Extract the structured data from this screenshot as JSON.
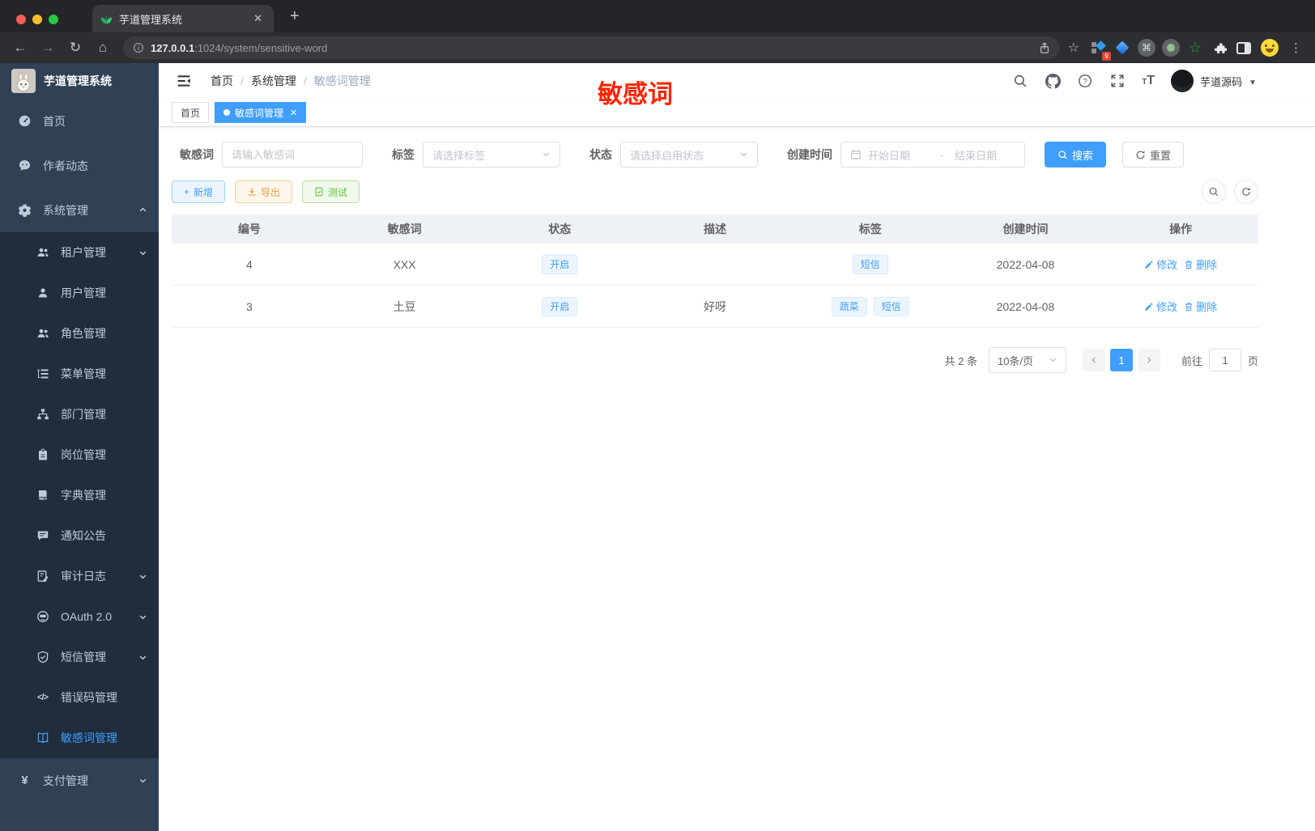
{
  "browser": {
    "tab_title": "芋道管理系统",
    "url_host": "127.0.0.1",
    "url_path": ":1024/system/sensitive-word",
    "extension_badge": "9",
    "extension_icons": [
      "grid-diamond-icon",
      "blue-gem-icon",
      "command-circle-icon",
      "green-dot-circle-icon",
      "green-star-icon",
      "puzzle-icon",
      "side-panel-icon",
      "profile-avatar"
    ]
  },
  "annotation": {
    "text": "敏感词",
    "color": "#ff2600"
  },
  "colors": {
    "accent": "#409eff",
    "sidebar_bg": "#304156",
    "submenu_bg": "#1f2d3d",
    "warning": "#e6a23c",
    "success": "#67c23a"
  },
  "sidebar": {
    "title": "芋道管理系统",
    "items": [
      {
        "label": "首页",
        "icon": "dashboard-icon",
        "level": 1
      },
      {
        "label": "作者动态",
        "icon": "chat-icon",
        "level": 1
      },
      {
        "label": "系统管理",
        "icon": "gear-icon",
        "level": 1,
        "expanded": true
      },
      {
        "label": "租户管理",
        "icon": "tenant-icon",
        "level": 2,
        "arrow": "down"
      },
      {
        "label": "用户管理",
        "icon": "user-icon",
        "level": 2
      },
      {
        "label": "角色管理",
        "icon": "role-icon",
        "level": 2
      },
      {
        "label": "菜单管理",
        "icon": "menu-tree-icon",
        "level": 2
      },
      {
        "label": "部门管理",
        "icon": "org-chart-icon",
        "level": 2
      },
      {
        "label": "岗位管理",
        "icon": "badge-icon",
        "level": 2
      },
      {
        "label": "字典管理",
        "icon": "dictionary-icon",
        "level": 2
      },
      {
        "label": "通知公告",
        "icon": "notice-icon",
        "level": 2
      },
      {
        "label": "审计日志",
        "icon": "audit-log-icon",
        "level": 2,
        "arrow": "down"
      },
      {
        "label": "OAuth 2.0",
        "icon": "oauth-icon",
        "level": 2,
        "arrow": "down"
      },
      {
        "label": "短信管理",
        "icon": "shield-check-icon",
        "level": 2,
        "arrow": "down"
      },
      {
        "label": "错误码管理",
        "icon": "code-icon",
        "level": 2
      },
      {
        "label": "敏感词管理",
        "icon": "open-book-icon",
        "level": 2,
        "active": true
      },
      {
        "label": "支付管理",
        "icon": "yen-icon",
        "level": 1,
        "arrow": "down"
      }
    ]
  },
  "header": {
    "breadcrumb": [
      "首页",
      "系统管理",
      "敏感词管理"
    ],
    "separator": "/",
    "user_name": "芋道源码"
  },
  "tabs": [
    {
      "label": "首页",
      "active": false
    },
    {
      "label": "敏感词管理",
      "active": true
    }
  ],
  "filters": {
    "word_label": "敏感词",
    "word_placeholder": "请输入敏感词",
    "tag_label": "标签",
    "tag_placeholder": "请选择标签",
    "status_label": "状态",
    "status_placeholder": "请选择启用状态",
    "time_label": "创建时间",
    "start_placeholder": "开始日期",
    "range_separator": "-",
    "end_placeholder": "结束日期",
    "search_label": "搜索",
    "reset_label": "重置"
  },
  "toolbar": {
    "add_label": "新增",
    "export_label": "导出",
    "test_label": "测试"
  },
  "table": {
    "columns": [
      "编号",
      "敏感词",
      "状态",
      "描述",
      "标签",
      "创建时间",
      "操作"
    ],
    "edit_label": "修改",
    "delete_label": "删除",
    "rows": [
      {
        "id": "4",
        "word": "XXX",
        "status": "开启",
        "desc": "",
        "tags": [
          "短信"
        ],
        "date": "2022-04-08"
      },
      {
        "id": "3",
        "word": "土豆",
        "status": "开启",
        "desc": "好呀",
        "tags": [
          "蔬菜",
          "短信"
        ],
        "date": "2022-04-08"
      }
    ]
  },
  "pagination": {
    "total": "共 2 条",
    "page_size": "10条/页",
    "page": "1",
    "goto_label": "前往",
    "goto_value": "1",
    "page_unit": "页"
  }
}
